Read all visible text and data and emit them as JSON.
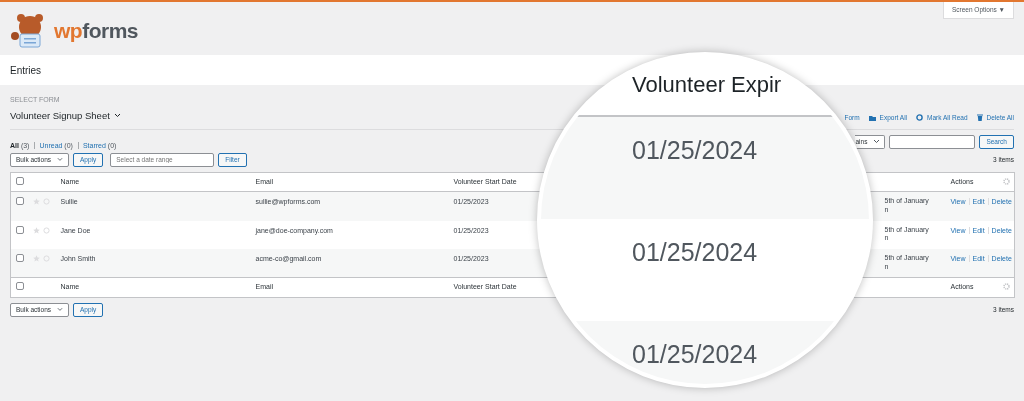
{
  "header": {
    "logo": [
      "wp",
      "forms"
    ],
    "screen_options": "Screen Options",
    "screen_options_caret": "▼"
  },
  "page_title": "Entries",
  "select_form": {
    "label": "SELECT FORM",
    "value": "Volunteer Signup Sheet"
  },
  "toolbar_actions": [
    {
      "kind": "form",
      "label": "Form"
    },
    {
      "kind": "export",
      "label": "Export All"
    },
    {
      "kind": "mark-read",
      "label": "Mark All Read"
    },
    {
      "kind": "delete",
      "label": "Delete All"
    }
  ],
  "views": [
    {
      "label": "All",
      "count": "(3)",
      "selected": true
    },
    {
      "label": "Unread",
      "count": "(0)",
      "selected": false
    },
    {
      "label": "Starred",
      "count": "(0)",
      "selected": false
    }
  ],
  "bulk_actions_top": {
    "value": "Bulk actions",
    "apply": "Apply"
  },
  "date_filter": {
    "placeholder": "Select a date range",
    "button": "Filter"
  },
  "search": {
    "field_select": "ains",
    "button": "Search"
  },
  "items_count_top": "3 items",
  "table": {
    "header_checked": false,
    "footer_checked": false,
    "columns": [
      "Name",
      "Email",
      "Volunteer Start Date",
      "Actions"
    ],
    "rows": [
      {
        "checked": false,
        "starred": false,
        "read": true,
        "name": "Sullie",
        "email": "sullie@wpforms.com",
        "start_date": "01/25/2023",
        "column_6": "5th of January\nn",
        "actions": [
          "View",
          "Edit",
          "Delete"
        ]
      },
      {
        "checked": false,
        "starred": false,
        "read": true,
        "name": "Jane Doe",
        "email": "jane@doe-company.com",
        "start_date": "01/25/2023",
        "column_6": "5th of January\nn",
        "actions": [
          "View",
          "Edit",
          "Delete"
        ]
      },
      {
        "checked": false,
        "starred": false,
        "read": true,
        "name": "John Smith",
        "email": "acme-co@gmail.com",
        "start_date": "01/25/2023",
        "column_6": "5th of January\nn",
        "actions": [
          "View",
          "Edit",
          "Delete"
        ]
      }
    ],
    "footer_columns": [
      "Name",
      "Email",
      "Volunteer Start Date",
      "Actions"
    ]
  },
  "bulk_actions_bottom": {
    "value": "Bulk actions",
    "apply": "Apply"
  },
  "items_count_bottom": "3 items",
  "magnifier": {
    "heading": "Volunteer Expir",
    "values": [
      "01/25/2024",
      "01/25/2024",
      "01/25/2024"
    ]
  }
}
